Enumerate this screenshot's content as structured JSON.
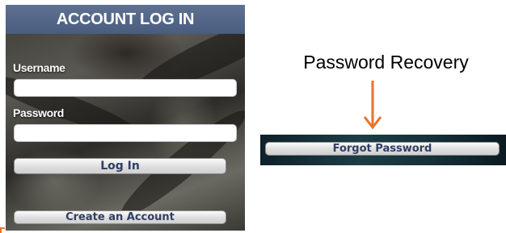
{
  "login": {
    "title": "ACCOUNT LOG IN",
    "username_label": "Username",
    "username_value": "",
    "password_label": "Password",
    "password_value": "",
    "login_button": "Log In",
    "create_account_button": "Create an Account"
  },
  "recovery": {
    "title": "Password Recovery",
    "forgot_button": "Forgot Password"
  },
  "colors": {
    "header": "#52668a",
    "button_text": "#2f3f63",
    "arrow": "#e8732c",
    "strip": "#1c3d46"
  },
  "icons": {
    "arrow": "arrow-down-icon"
  }
}
